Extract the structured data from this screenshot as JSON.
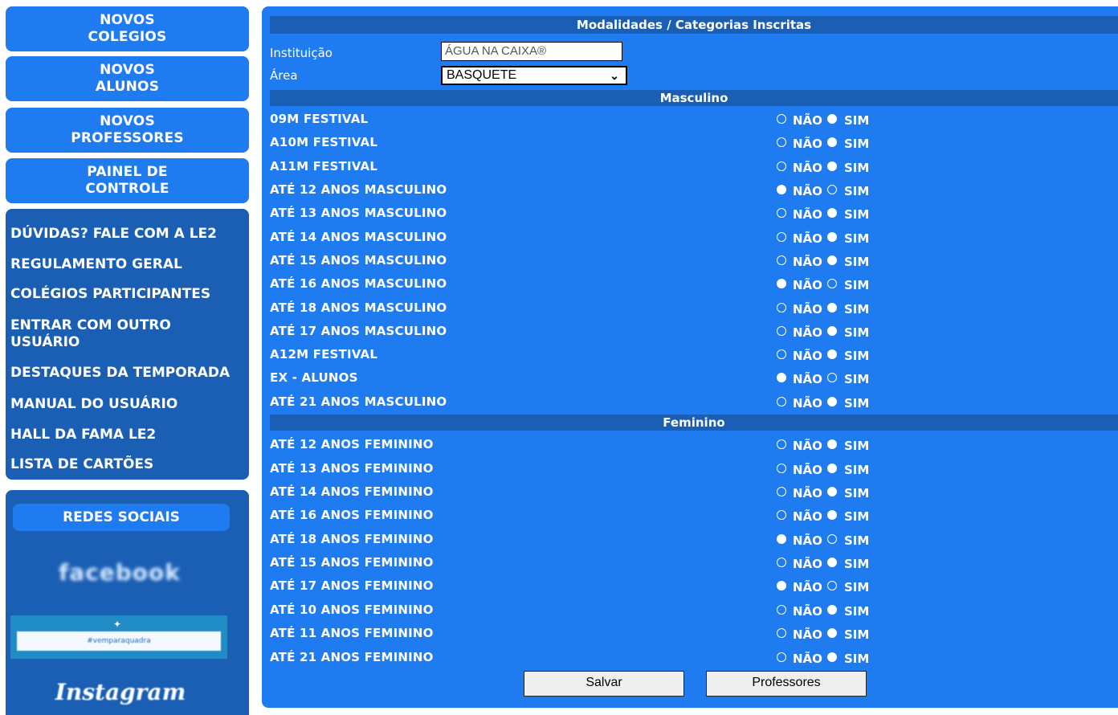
{
  "sidebar": {
    "buttons": [
      {
        "label": "NOVOS\nCOLEGIOS"
      },
      {
        "label": "NOVOS\nALUNOS"
      },
      {
        "label": "NOVOS\nPROFESSORES"
      },
      {
        "label": "PAINEL DE\nCONTROLE"
      }
    ],
    "menu": [
      {
        "label": "DÚVIDAS? FALE COM A LE2"
      },
      {
        "label": "REGULAMENTO GERAL"
      },
      {
        "label": "COLÉGIOS PARTICIPANTES"
      },
      {
        "label": "ENTRAR COM OUTRO USUÁRIO"
      },
      {
        "label": "DESTAQUES DA TEMPORADA"
      },
      {
        "label": "MANUAL DO USUÁRIO"
      },
      {
        "label": "HALL DA FAMA LE2"
      },
      {
        "label": "LISTA DE CARTÕES"
      }
    ],
    "social": {
      "title": "REDES SOCIAIS",
      "facebook": "facebook",
      "le2_logo_text": "#vemparaquadra",
      "instagram": "Instagram"
    }
  },
  "form": {
    "title": "Modalidades / Categorias Inscritas",
    "institution_label": "Instituição",
    "institution_value": "ÁGUA NA CAIXA®",
    "area_label": "Área",
    "area_value": "BASQUETE",
    "option_no": "NÃO",
    "option_yes": "SIM",
    "masculino": {
      "title": "Masculino",
      "rows": [
        {
          "label": "09M FESTIVAL",
          "value": "SIM"
        },
        {
          "label": "A10M FESTIVAL",
          "value": "SIM"
        },
        {
          "label": "A11M FESTIVAL",
          "value": "SIM"
        },
        {
          "label": "ATÉ 12 ANOS MASCULINO",
          "value": "NÃO"
        },
        {
          "label": "ATÉ 13 ANOS MASCULINO",
          "value": "SIM"
        },
        {
          "label": "ATÉ 14 ANOS MASCULINO",
          "value": "SIM"
        },
        {
          "label": "ATÉ 15 ANOS MASCULINO",
          "value": "SIM"
        },
        {
          "label": "ATÉ 16 ANOS MASCULINO",
          "value": "NÃO"
        },
        {
          "label": "ATÉ 18 ANOS MASCULINO",
          "value": "SIM"
        },
        {
          "label": "ATÉ 17 ANOS MASCULINO",
          "value": "SIM"
        },
        {
          "label": "A12M FESTIVAL",
          "value": "SIM"
        },
        {
          "label": "EX - ALUNOS",
          "value": "NÃO"
        },
        {
          "label": "ATÉ 21 ANOS MASCULINO",
          "value": "SIM"
        }
      ]
    },
    "feminino": {
      "title": "Feminino",
      "rows": [
        {
          "label": "ATÉ 12 ANOS FEMININO",
          "value": "SIM"
        },
        {
          "label": "ATÉ 13 ANOS FEMININO",
          "value": "SIM"
        },
        {
          "label": "ATÉ 14 ANOS FEMININO",
          "value": "SIM"
        },
        {
          "label": "ATÉ 16 ANOS FEMININO",
          "value": "SIM"
        },
        {
          "label": "ATÉ 18 ANOS FEMININO",
          "value": "NÃO"
        },
        {
          "label": "ATÉ 15 ANOS FEMININO",
          "value": "SIM"
        },
        {
          "label": "ATÉ 17 ANOS FEMININO",
          "value": "NÃO"
        },
        {
          "label": "ATÉ 10 ANOS FEMININO",
          "value": "SIM"
        },
        {
          "label": "ATÉ 11 ANOS FEMININO",
          "value": "SIM"
        },
        {
          "label": "ATÉ 21 ANOS FEMININO",
          "value": "SIM"
        }
      ]
    },
    "save_label": "Salvar",
    "professors_label": "Professores"
  },
  "colors": {
    "primary_blue": "#1f7bf0",
    "dark_blue": "#1a5fb4",
    "text": "#ffffff"
  }
}
